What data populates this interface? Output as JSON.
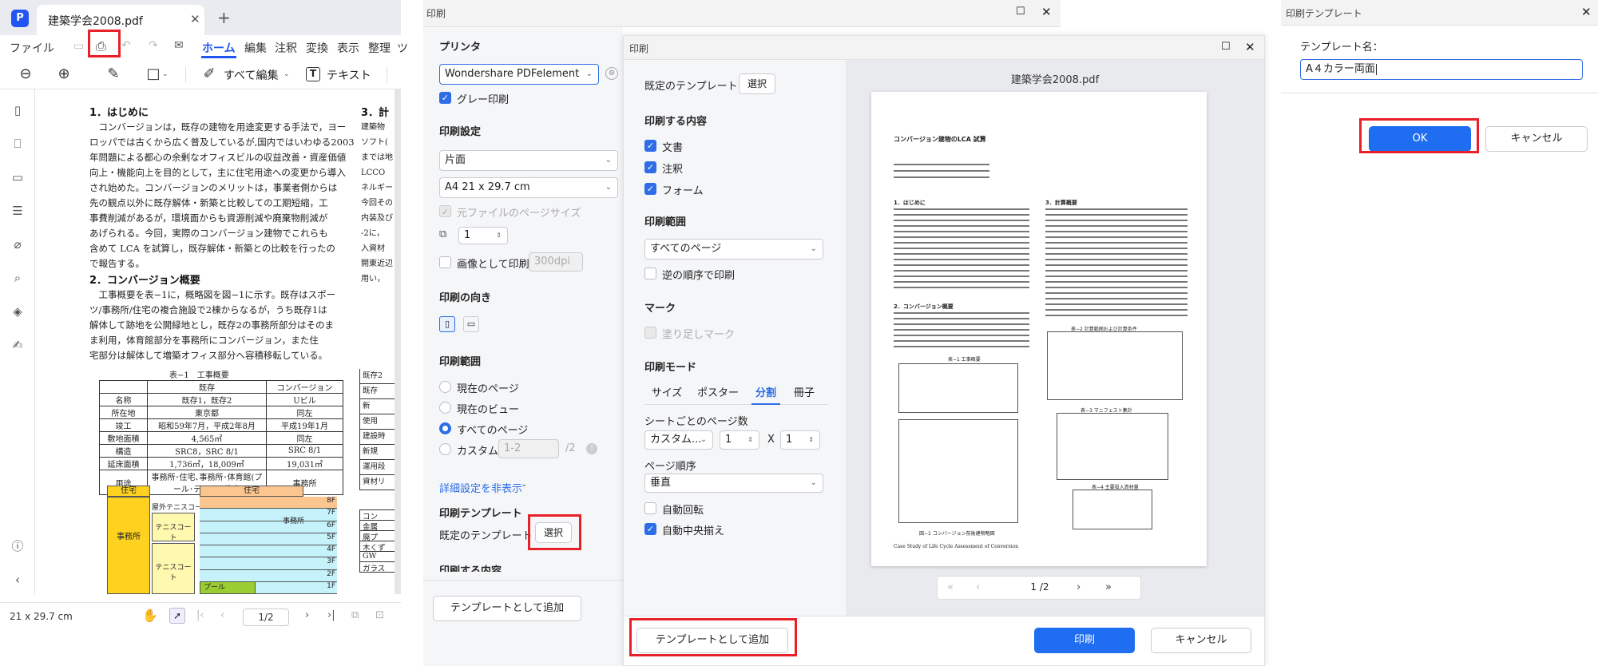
{
  "main_window": {
    "tab_title": "建築学会2008.pdf",
    "menu": [
      "ファイル",
      "ホーム",
      "編集",
      "注釈",
      "変換",
      "表示",
      "整理",
      "ツ"
    ],
    "active_menu": "ホーム",
    "toolbar": {
      "edit_all": "すべて編集",
      "text": "テキスト"
    },
    "document": {
      "sec1_title": "1．はじめに",
      "sec1_lines": [
        "　コンバージョンは，既存の建物を用途変更する手法で，ヨー",
        "ロッパでは古くから広く普及しているが,国内ではいわゆる2003",
        "年問題による都心の余剰なオフィスビルの収益改善・資産価値",
        "向上・機能向上を目的として，主に住宅用途への変更から導入",
        "され始めた。コンバージョンのメリットは，事業者側からは",
        "先の観点以外に既存解体・新築と比較しての工期短縮，工",
        "事費削減があるが，環境面からも資源削減や廃棄物削減が",
        "あげられる。今回，実際のコンバージョン建物でこれらも",
        "含めて LCA を試算し，既存解体・新築との比較を行ったの",
        "で報告する。"
      ],
      "sec2_title": "2．コンバージョン概要",
      "sec2_lines": [
        "　工事概要を表−1に，概略図を図−1に示す。既存はスポー",
        "ツ/事務所/住宅の複合施設で2棟からなるが，うち既存1は",
        "解体して跡地を公開緑地とし，既存2の事務所部分はそのま",
        "ま利用，体育館部分を事務所にコンバージョン，また住",
        "宅部分は解体して増築オフィス部分へ容積移転している。"
      ],
      "sec3_title": "3．計",
      "sec3_lines": [
        "建築物",
        "ソフト(",
        "までは地",
        "LCCO",
        "ネルギー",
        "今回その",
        "内装及び",
        "-2に，",
        "入資材",
        "開東近辺",
        "用い，"
      ],
      "table_caption": "表−1　工事概要",
      "table_header": [
        "",
        "既存",
        "コンバージョン"
      ],
      "table_rows": [
        [
          "名称",
          "既存1，既存2",
          "Uビル"
        ],
        [
          "所在地",
          "東京都",
          "同左"
        ],
        [
          "竣工",
          "昭和59年7月，平成2年8月",
          "平成19年1月"
        ],
        [
          "敷地面積",
          "4,565㎡",
          "同左"
        ],
        [
          "構造",
          "SRC8，SRC 8/1",
          "SRC 8/1"
        ],
        [
          "延床面積",
          "1,736㎡，18,009㎡",
          "19,031㎡"
        ],
        [
          "用途",
          "事務所･住宅､事務所･体育館(プール･テニス)･住宅",
          "事務所"
        ]
      ],
      "right_table_labels": [
        "既存2",
        "既存",
        "新",
        "使用",
        "建設時",
        "新規",
        "運用段",
        "資材リ"
      ],
      "right_table2_labels": [
        "コン",
        "金属",
        "廃プ",
        "木くず",
        "GW",
        "ガラス"
      ],
      "floorplan": {
        "house": "住宅",
        "office": "事務所",
        "outdoor_tennis": "屋外テニスコート",
        "tennis1": "テニスコート",
        "tennis2": "テニスコート",
        "office2": "事務所",
        "pool": "プール",
        "floors": [
          "8F",
          "7F",
          "6F",
          "5F",
          "4F",
          "3F",
          "2F",
          "1F"
        ]
      }
    },
    "status": {
      "page_size": "21 x 29.7 cm",
      "page_indicator": "1/2"
    }
  },
  "print_dialog_back": {
    "title": "印刷",
    "printer_section": "プリンタ",
    "printer": "Wondershare PDFelement",
    "gray_print": "グレー印刷",
    "settings_section": "印刷設定",
    "sides": "片面",
    "paper": "A4 21 x 29.7 cm",
    "original_size": "元ファイルのページサイズ",
    "copies": "1",
    "print_as_image": "画像として印刷",
    "dpi": "300dpi",
    "orientation_section": "印刷の向き",
    "range_section": "印刷範囲",
    "range_options": [
      "現在のページ",
      "現在のビュー",
      "すべてのページ",
      "カスタム"
    ],
    "custom_range": "1-2",
    "custom_total": "/2",
    "hide_details": "詳細設定を非表示",
    "template_section": "印刷テンプレート",
    "default_template": "既定のテンプレート",
    "select_button": "選択",
    "cut_section": "印刷する内容",
    "add_template_button": "テンプレートとして追加"
  },
  "print_dialog_front": {
    "title": "印刷",
    "default_template": "既定のテンプレート",
    "select_button": "選択",
    "content_section": "印刷する内容",
    "content_items": [
      "文書",
      "注釈",
      "フォーム"
    ],
    "range_section": "印刷範囲",
    "range_value": "すべてのページ",
    "reverse_order": "逆の順序で印刷",
    "marks_section": "マーク",
    "bleed_marks": "塗り足しマーク",
    "mode_section": "印刷モード",
    "mode_tabs": [
      "サイズ",
      "ポスター",
      "分割",
      "冊子"
    ],
    "active_mode": "分割",
    "pages_per_sheet_label": "シートごとのページ数",
    "pages_per_sheet": "カスタム...",
    "rows": "1",
    "x_label": "X",
    "cols": "1",
    "page_order_label": "ページ順序",
    "page_order": "垂直",
    "auto_rotate": "自動回転",
    "auto_center": "自動中央揃え",
    "preview_filename": "建築学会2008.pdf",
    "preview": {
      "doc_title": "コンバージョン建物のLCA 試算",
      "sec1": "1．はじめに",
      "sec2": "2．コンバージョン概要",
      "sec3": "3．計算概要",
      "table1": "表−1 工事概要",
      "table2": "表−2 計算範囲および計算条件",
      "table3": "表−3 マニフェスト集計",
      "table4": "表−4 主要投入資材量",
      "figure": "図−1 コンバージョン前後建物略図",
      "footer": "Case Study of Life Cycle Assessment of Conversion"
    },
    "page_indicator": "1 /2",
    "add_template_button": "テンプレートとして追加",
    "print_button": "印刷",
    "cancel_button": "キャンセル"
  },
  "template_dialog": {
    "title": "印刷テンプレート",
    "name_label": "テンプレート名：",
    "name_value": "A４カラー両面",
    "ok_button": "OK",
    "cancel_button": "キャンセル"
  },
  "colors": {
    "accent": "#1f6df0",
    "highlight": "#e8202a",
    "floor_yellow": "#ffd21f",
    "floor_cyan": "#c6f3fb",
    "floor_orange": "#fbc590",
    "floor_green": "#9acd32"
  }
}
